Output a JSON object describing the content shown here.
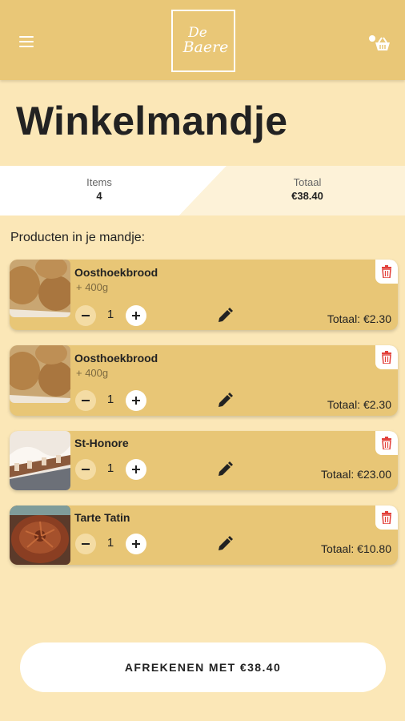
{
  "app": {
    "logo_line1": "De",
    "logo_line2": "Baere"
  },
  "page": {
    "title": "Winkelmandje"
  },
  "summary": {
    "items_label": "Items",
    "items_value": "4",
    "total_label": "Totaal",
    "total_value": "€38.40"
  },
  "section_label": "Producten in je mandje:",
  "cart": [
    {
      "name": "Oosthoekbrood",
      "variant": "+ 400g",
      "quantity": "1",
      "total": "Totaal: €2.30"
    },
    {
      "name": "Oosthoekbrood",
      "variant": "+ 400g",
      "quantity": "1",
      "total": "Totaal: €2.30"
    },
    {
      "name": "St-Honore",
      "quantity": "1",
      "total": "Totaal: €23.00"
    },
    {
      "name": "Tarte Tatin",
      "quantity": "1",
      "total": "Totaal: €10.80"
    }
  ],
  "checkout": {
    "label": "AFREKENEN MET €38.40"
  },
  "icons": {
    "menu": "hamburger-menu-icon",
    "account_cart": "account-basket-icon",
    "edit": "pencil-icon",
    "delete": "trash-icon",
    "minus": "minus-icon",
    "plus": "plus-icon"
  },
  "colors": {
    "header": "#e9c777",
    "background": "#fbe7b7",
    "card": "#e8c676",
    "delete_accent": "#e2403a"
  }
}
